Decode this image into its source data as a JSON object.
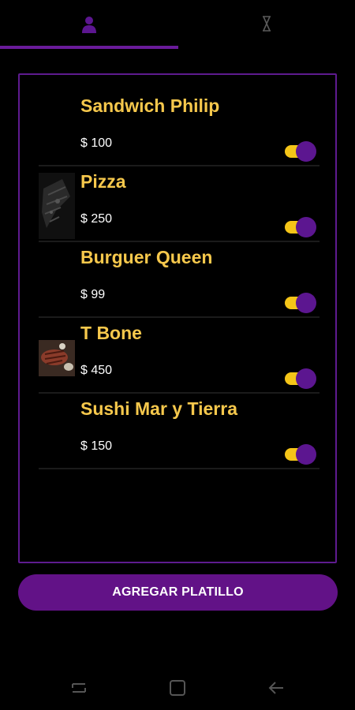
{
  "colors": {
    "accent": "#621287",
    "dish_name": "#f6c84c",
    "switch_track": "#f5c518",
    "switch_knob": "#5c1690",
    "background": "#000000"
  },
  "tabs": [
    {
      "icon": "person-icon",
      "selected": true
    },
    {
      "icon": "hourglass-icon",
      "selected": false
    }
  ],
  "dishes": [
    {
      "name": "Sandwich Philip",
      "price": "$ 100",
      "image": "none",
      "enabled": true
    },
    {
      "name": "Pizza",
      "price": "$ 250",
      "image": "pizza-photo",
      "enabled": true
    },
    {
      "name": "Burguer Queen",
      "price": "$ 99",
      "image": "none",
      "enabled": true
    },
    {
      "name": "T Bone",
      "price": "$ 450",
      "image": "steak-photo",
      "enabled": true
    },
    {
      "name": "Sushi Mar y Tierra",
      "price": "$ 150",
      "image": "none",
      "enabled": true
    }
  ],
  "add_button": {
    "label": "AGREGAR PLATILLO"
  },
  "nav": [
    "recents-icon",
    "home-icon",
    "back-icon"
  ]
}
